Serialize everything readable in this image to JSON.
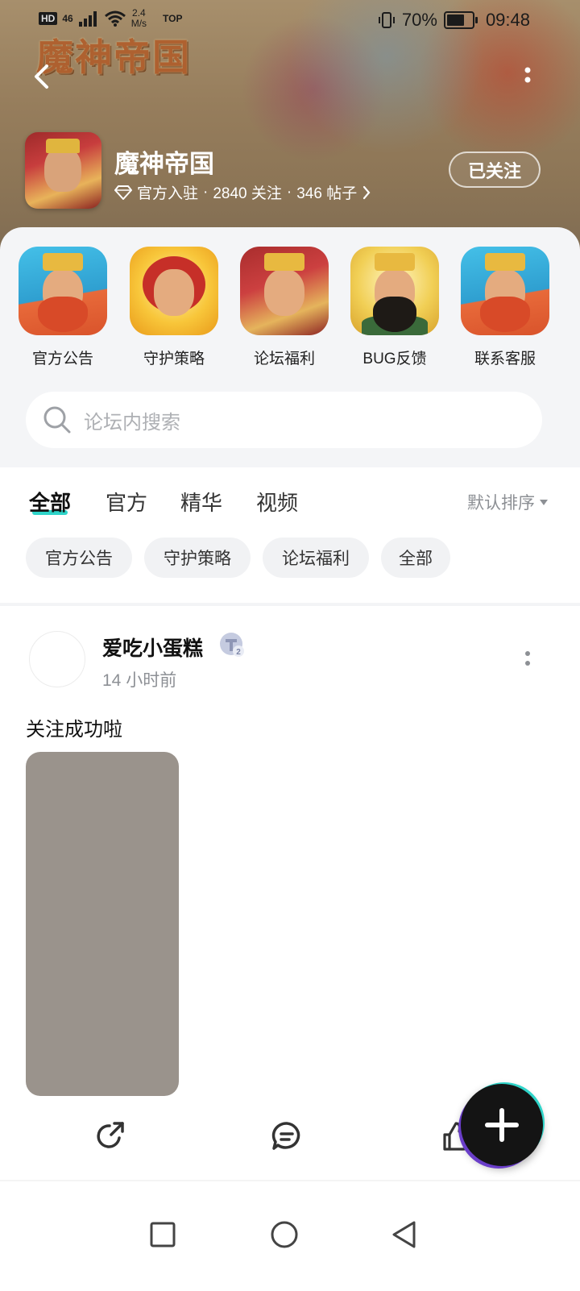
{
  "status_bar": {
    "hd_label": "HD",
    "signal_label": "46",
    "net_speed_value": "2.4",
    "net_speed_unit": "M/s",
    "top_label": "TOP",
    "battery_percent": "70%",
    "time": "09:48"
  },
  "header": {
    "banner_logo_text": "魔神帝国",
    "game_title": "魔神帝国",
    "meta": {
      "official_label": "官方入驻",
      "sep1": "·",
      "followers": "2840 关注",
      "sep2": "·",
      "posts": "346 帖子"
    },
    "follow_button_label": "已关注"
  },
  "shortcuts": [
    {
      "label": "官方公告",
      "icon": "dwarf-king-portrait"
    },
    {
      "label": "守护策略",
      "icon": "red-hair-hero-portrait"
    },
    {
      "label": "论坛福利",
      "icon": "golden-king-portrait"
    },
    {
      "label": "BUG反馈",
      "icon": "bearded-general-portrait"
    },
    {
      "label": "联系客服",
      "icon": "dwarf-king-portrait"
    }
  ],
  "search": {
    "placeholder": "论坛内搜索"
  },
  "tabs": [
    {
      "label": "全部",
      "active": true
    },
    {
      "label": "官方",
      "active": false
    },
    {
      "label": "精华",
      "active": false
    },
    {
      "label": "视频",
      "active": false
    }
  ],
  "sort_label": "默认排序",
  "chips": [
    {
      "label": "官方公告"
    },
    {
      "label": "守护策略"
    },
    {
      "label": "论坛福利"
    },
    {
      "label": "全部"
    }
  ],
  "post": {
    "username": "爱吃小蛋糕",
    "level_badge_label": "2",
    "time": "14 小时前",
    "text": "关注成功啦",
    "image_color": "#9a938c"
  },
  "colors": {
    "accent_teal": "#2fd4c9",
    "accent_purple": "#6a3ec9",
    "panel_bg": "#f4f5f7"
  }
}
